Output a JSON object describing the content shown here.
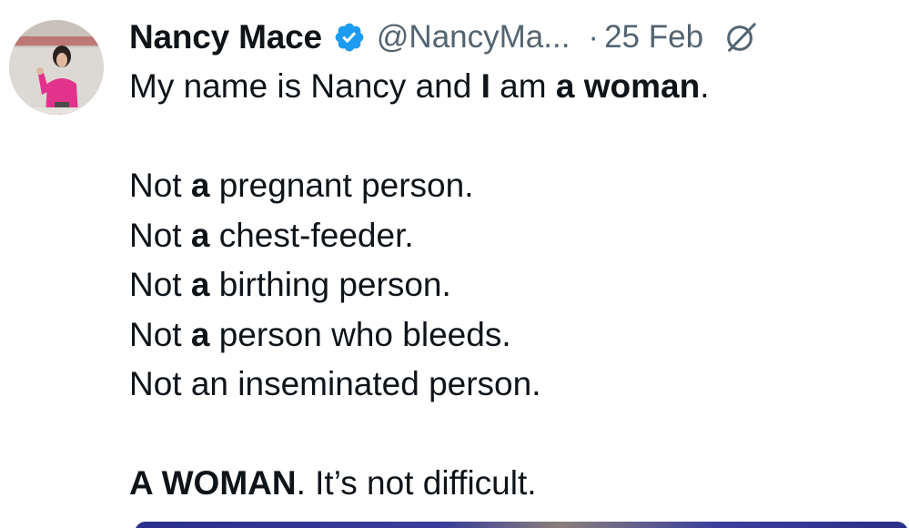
{
  "tweet": {
    "author": {
      "display_name": "Nancy Mace",
      "handle": "@NancyMa...",
      "verified_icon": "verified-badge-icon",
      "verified_color": "#1d9bf0"
    },
    "separator": "·",
    "timestamp": "25 Feb",
    "grok_icon": "grok-icon",
    "text": {
      "l1": {
        "a": "My name is Nancy and ",
        "b": "I",
        "c": " am ",
        "d": "a woman",
        "e": "."
      },
      "l2": {
        "a": "Not ",
        "b": "a",
        "c": " pregnant person."
      },
      "l3": {
        "a": "Not ",
        "b": "a",
        "c": " chest-feeder."
      },
      "l4": {
        "a": "Not ",
        "b": "a",
        "c": " birthing person."
      },
      "l5": {
        "a": "Not ",
        "b": "a",
        "c": " person who bleeds."
      },
      "l6": {
        "a": "Not an inseminated person."
      },
      "l7": {
        "a": "A WOMAN",
        "b": ".  It’s not difficult."
      }
    }
  },
  "colors": {
    "text_primary": "#0f1419",
    "text_secondary": "#536471",
    "accent": "#1d9bf0"
  }
}
